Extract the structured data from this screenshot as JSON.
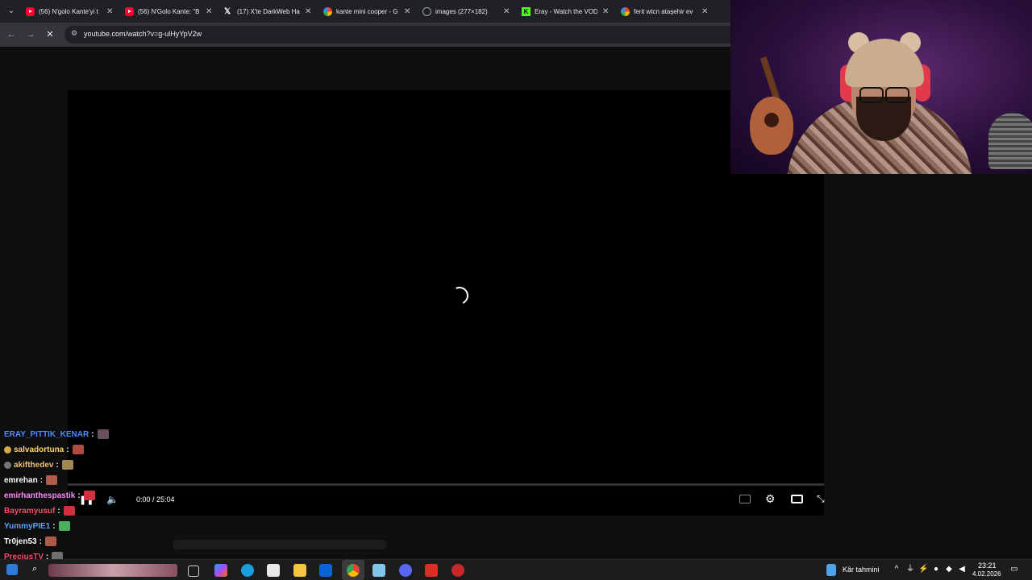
{
  "browser": {
    "tabs": [
      {
        "title": "(56) N'golo Kante'yi t",
        "favicon": "youtube-icon"
      },
      {
        "title": "(56) N'Golo Kante: \"B",
        "favicon": "youtube-icon"
      },
      {
        "title": "(17) X'te DarkWeb Ha",
        "favicon": "x-icon"
      },
      {
        "title": "kante mini cooper - G",
        "favicon": "google-icon"
      },
      {
        "title": "images (277×182)",
        "favicon": "globe-icon"
      },
      {
        "title": "Eray - Watch the VOD",
        "favicon": "kick-icon"
      },
      {
        "title": "ferit wtcn ataşehir ev",
        "favicon": "google-icon"
      }
    ],
    "url": "youtube.com/watch?v=g-ulHyYpV2w"
  },
  "player": {
    "time_display": "0:00 / 25:04",
    "state": "loading"
  },
  "chat": [
    {
      "user": "ERAY_PITTIK_KENAR",
      "color": "#4a90ff",
      "badge": ""
    },
    {
      "user": "salvadortuna",
      "color": "#ffd86b",
      "badge": "#d4a94a"
    },
    {
      "user": "akifthedev",
      "color": "#f0c674",
      "badge": "#777777"
    },
    {
      "user": "emrehan",
      "color": "#ffffff",
      "badge": ""
    },
    {
      "user": "emirhanthespastik",
      "color": "#ff8cff",
      "badge": ""
    },
    {
      "user": "Bayramyusuf",
      "color": "#ff4d6d",
      "badge": ""
    },
    {
      "user": "YummyPIE1",
      "color": "#5aa9ff",
      "badge": ""
    },
    {
      "user": "Tr0jen53",
      "color": "#ffffff",
      "badge": ""
    },
    {
      "user": "PreciusTV",
      "color": "#ff4d6d",
      "badge": ""
    }
  ],
  "taskbar": {
    "weather": "Kâr tahmini",
    "time": "23:21",
    "date": "4.02.2026"
  }
}
